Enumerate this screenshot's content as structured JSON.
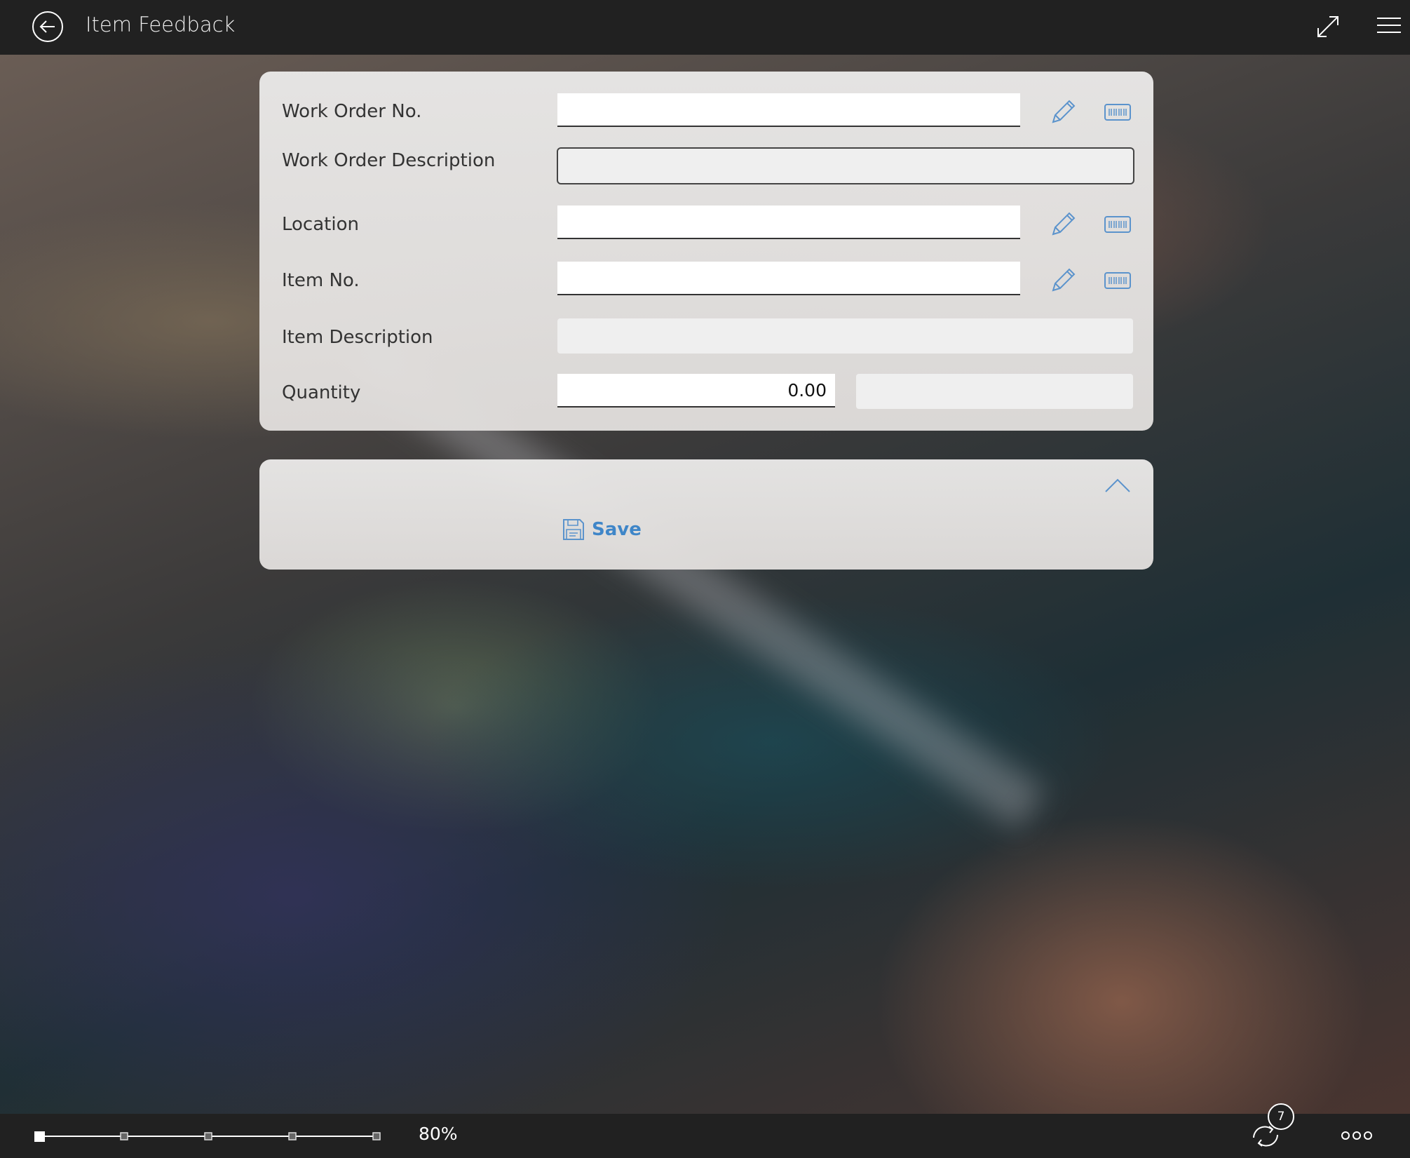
{
  "header": {
    "title": "Item Feedback"
  },
  "form": {
    "work_order_no": {
      "label": "Work Order No.",
      "value": ""
    },
    "work_order_description": {
      "label": "Work Order Description",
      "value": ""
    },
    "location": {
      "label": "Location",
      "value": ""
    },
    "item_no": {
      "label": "Item No.",
      "value": ""
    },
    "item_description": {
      "label": "Item Description",
      "value": ""
    },
    "quantity": {
      "label": "Quantity",
      "value": "0.00",
      "unit": ""
    }
  },
  "actions": {
    "save_label": "Save"
  },
  "footer": {
    "zoom": "80%",
    "sync_count": "7",
    "zoom_slider_position": 0.0
  },
  "icons": {
    "back": "back-arrow-circle-icon",
    "expand": "expand-arrows-icon",
    "menu": "hamburger-menu-icon",
    "edit": "pencil-icon",
    "barcode": "barcode-keyboard-icon",
    "collapse": "chevron-up-icon",
    "save": "floppy-disk-icon",
    "sync": "sync-icon",
    "more": "ellipsis-icon"
  },
  "colors": {
    "accent": "#3f86c8",
    "bar": "#212121"
  }
}
